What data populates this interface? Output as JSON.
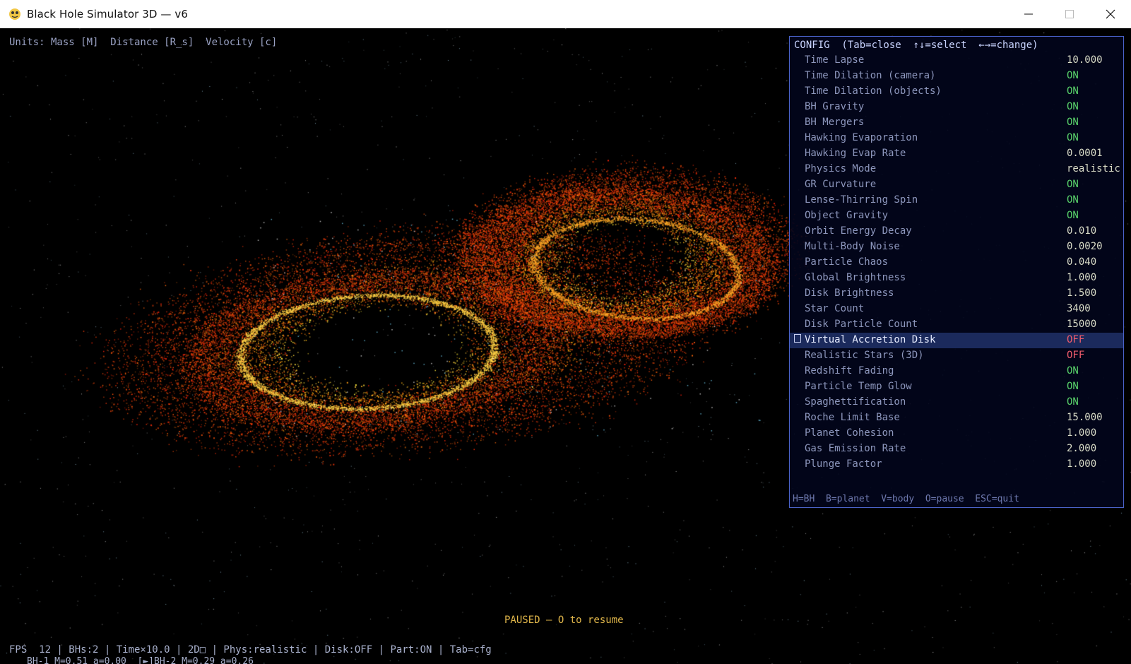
{
  "window": {
    "title": "Black Hole Simulator 3D  —  v6"
  },
  "hud": {
    "units": "Units: Mass [M]  Distance [R_s]  Velocity [c]",
    "paused": "PAUSED — O to resume",
    "status": "FPS  12 | BHs:2 | Time×10.0 | 2D□ | Phys:realistic | Disk:OFF | Part:ON | Tab=cfg",
    "bh_info": "BH-1 M=0.51 a=0.00  [►]BH-2 M=0.29 a=0.26"
  },
  "config": {
    "header": "CONFIG  (Tab=close  ↑↓=select  ←→=change)",
    "footer": "H=BH  B=planet  V=body  O=pause  ESC=quit",
    "rows": [
      {
        "label": "Time Lapse",
        "value": "10.000",
        "kind": "num"
      },
      {
        "label": "Time Dilation (camera)",
        "value": "ON",
        "kind": "on"
      },
      {
        "label": "Time Dilation (objects)",
        "value": "ON",
        "kind": "on"
      },
      {
        "label": "BH Gravity",
        "value": "ON",
        "kind": "on"
      },
      {
        "label": "BH Mergers",
        "value": "ON",
        "kind": "on"
      },
      {
        "label": "Hawking Evaporation",
        "value": "ON",
        "kind": "on"
      },
      {
        "label": "Hawking Evap Rate",
        "value": "0.0001",
        "kind": "num"
      },
      {
        "label": "Physics Mode",
        "value": "realistic",
        "kind": "num"
      },
      {
        "label": "GR Curvature",
        "value": "ON",
        "kind": "on"
      },
      {
        "label": "Lense-Thirring Spin",
        "value": "ON",
        "kind": "on"
      },
      {
        "label": "Object Gravity",
        "value": "ON",
        "kind": "on"
      },
      {
        "label": "Orbit Energy Decay",
        "value": "0.010",
        "kind": "num"
      },
      {
        "label": "Multi-Body Noise",
        "value": "0.0020",
        "kind": "num"
      },
      {
        "label": "Particle Chaos",
        "value": "0.040",
        "kind": "num"
      },
      {
        "label": "Global Brightness",
        "value": "1.000",
        "kind": "num"
      },
      {
        "label": "Disk Brightness",
        "value": "1.500",
        "kind": "num"
      },
      {
        "label": "Star Count",
        "value": "3400",
        "kind": "num"
      },
      {
        "label": "Disk Particle Count",
        "value": "15000",
        "kind": "num"
      },
      {
        "label": "Virtual Accretion Disk",
        "value": "OFF",
        "kind": "off",
        "selected": true
      },
      {
        "label": "Realistic Stars (3D)",
        "value": "OFF",
        "kind": "off"
      },
      {
        "label": "Redshift Fading",
        "value": "ON",
        "kind": "on"
      },
      {
        "label": "Particle Temp Glow",
        "value": "ON",
        "kind": "on"
      },
      {
        "label": "Spaghettification",
        "value": "ON",
        "kind": "on"
      },
      {
        "label": "Roche Limit Base",
        "value": "15.000",
        "kind": "num"
      },
      {
        "label": "Planet Cohesion",
        "value": "1.000",
        "kind": "num"
      },
      {
        "label": "Gas Emission Rate",
        "value": "2.000",
        "kind": "num"
      },
      {
        "label": "Plunge Factor",
        "value": "1.000",
        "kind": "num"
      }
    ]
  },
  "colors": {
    "panel_border": "#4a62c8",
    "on": "#59d36b",
    "off": "#ef5c6c",
    "paused": "#e0b64a"
  }
}
